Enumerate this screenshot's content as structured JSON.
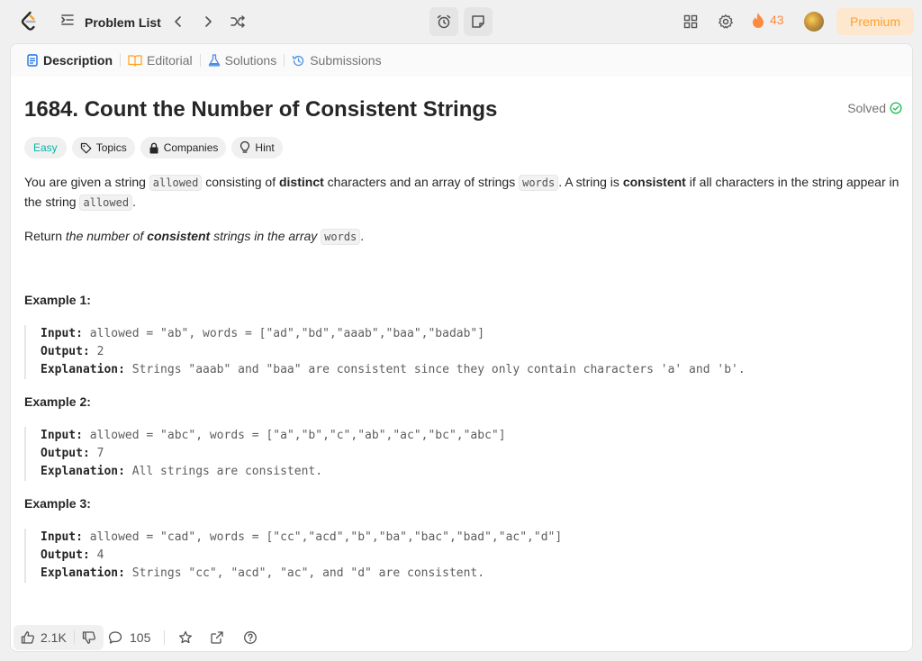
{
  "topbar": {
    "problem_list_label": "Problem List",
    "streak_count": "43",
    "premium_label": "Premium"
  },
  "tabs": [
    {
      "label": "Description",
      "icon": "document-icon",
      "active": true
    },
    {
      "label": "Editorial",
      "icon": "book-icon",
      "active": false
    },
    {
      "label": "Solutions",
      "icon": "flask-icon",
      "active": false
    },
    {
      "label": "Submissions",
      "icon": "history-icon",
      "active": false
    }
  ],
  "problem": {
    "title": "1684. Count the Number of Consistent Strings",
    "status": "Solved",
    "difficulty": "Easy",
    "tags": {
      "topics": "Topics",
      "companies": "Companies",
      "hint": "Hint"
    },
    "desc": {
      "p1_a": "You are given a string ",
      "p1_code1": "allowed",
      "p1_b": " consisting of ",
      "p1_bold1": "distinct",
      "p1_c": " characters and an array of strings ",
      "p1_code2": "words",
      "p1_d": ". A string is ",
      "p1_bold2": "consistent",
      "p1_e": " if all characters in the string appear in the string ",
      "p1_code3": "allowed",
      "p1_f": ".",
      "p2_a": "Return ",
      "p2_i1": "the number of ",
      "p2_bi": "consistent",
      "p2_i2": " strings in the array ",
      "p2_code": "words",
      "p2_b": "."
    },
    "examples": [
      {
        "title": "Example 1:",
        "input_key": "Input:",
        "input": " allowed = \"ab\", words = [\"ad\",\"bd\",\"aaab\",\"baa\",\"badab\"]",
        "output_key": "Output:",
        "output": " 2",
        "explanation_key": "Explanation:",
        "explanation": " Strings \"aaab\" and \"baa\" are consistent since they only contain characters 'a' and 'b'."
      },
      {
        "title": "Example 2:",
        "input_key": "Input:",
        "input": " allowed = \"abc\", words = [\"a\",\"b\",\"c\",\"ab\",\"ac\",\"bc\",\"abc\"]",
        "output_key": "Output:",
        "output": " 7",
        "explanation_key": "Explanation:",
        "explanation": " All strings are consistent."
      },
      {
        "title": "Example 3:",
        "input_key": "Input:",
        "input": " allowed = \"cad\", words = [\"cc\",\"acd\",\"b\",\"ba\",\"bac\",\"bad\",\"ac\",\"d\"]",
        "output_key": "Output:",
        "output": " 4",
        "explanation_key": "Explanation:",
        "explanation": " Strings \"cc\", \"acd\", \"ac\", and \"d\" are consistent."
      }
    ]
  },
  "bottombar": {
    "likes": "2.1K",
    "comments": "105"
  },
  "colors": {
    "accent_orange": "#ff8a3d",
    "premium_text": "#ff9f2d",
    "easy_teal": "#00b8a3",
    "solved_green": "#2cbb5d"
  }
}
